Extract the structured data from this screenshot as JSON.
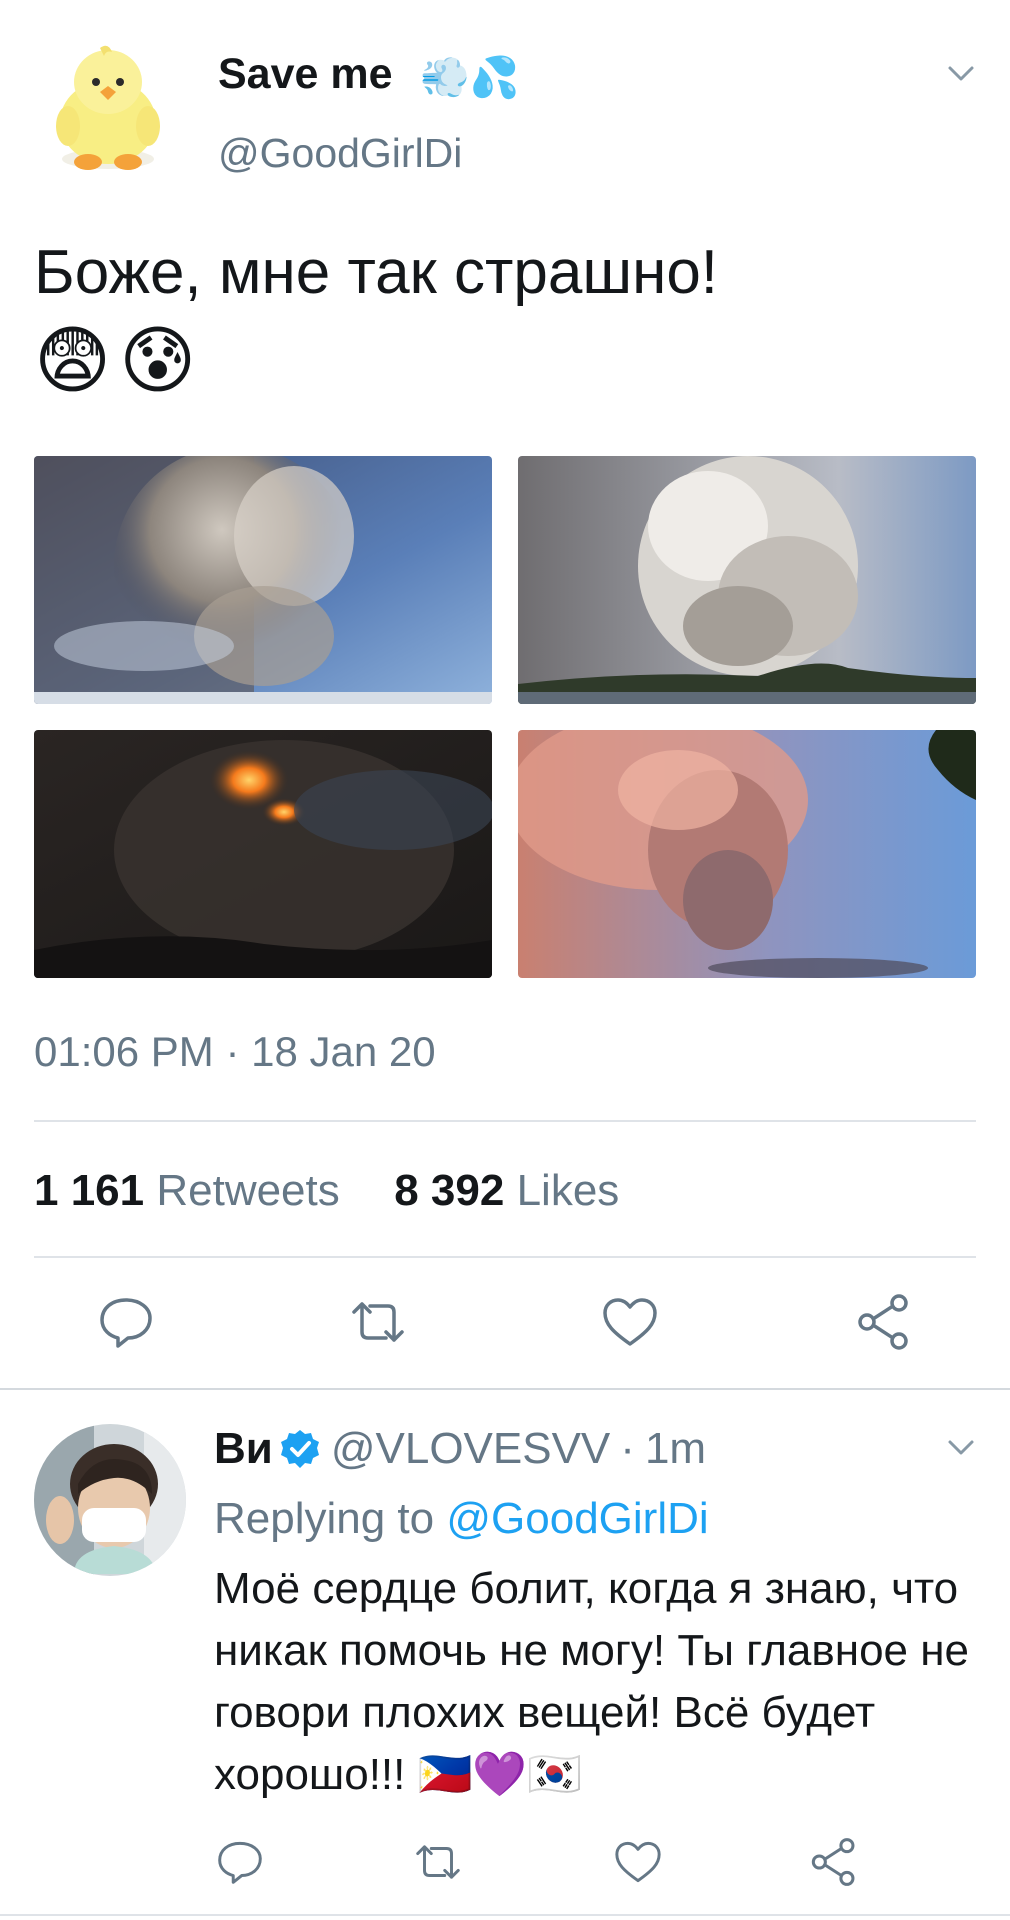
{
  "tweet": {
    "author_name": "Save me",
    "author_emoji": "💨💦",
    "author_handle": "@GoodGirlDi",
    "text": "Боже, мне так страшно!",
    "text_emoji": "😨😰",
    "timestamp": "01:06 PM · 18 Jan 20",
    "retweets_count": "1 161",
    "retweets_label": "Retweets",
    "likes_count": "8 392",
    "likes_label": "Likes",
    "photos": [
      {
        "name": "eruption-plume-photo"
      },
      {
        "name": "ash-column-photo"
      },
      {
        "name": "night-lava-photo"
      },
      {
        "name": "pink-sunset-plume-photo"
      }
    ]
  },
  "reply": {
    "author_name": "Ви",
    "author_handle": "@VLOVESVV",
    "separator": "·",
    "time": "1m",
    "replying_prefix": "Replying to",
    "replying_to": "@GoodGirlDi",
    "text": "Моё сердце болит, когда я знаю, что никак помочь не могу! Ты главное не говори плохих вещей! Всё будет хорошо!!! 🇵🇭💜🇰🇷"
  },
  "icons": {
    "reply": "reply-icon",
    "retweet": "retweet-icon",
    "like": "heart-icon",
    "share": "share-icon",
    "menu": "chevron-down-icon",
    "verified": "verified-badge-icon"
  },
  "colors": {
    "text": "#14171a",
    "secondary": "#657786",
    "link": "#1da1f2",
    "icon": "#657786",
    "divider": "#dfe3e8"
  }
}
